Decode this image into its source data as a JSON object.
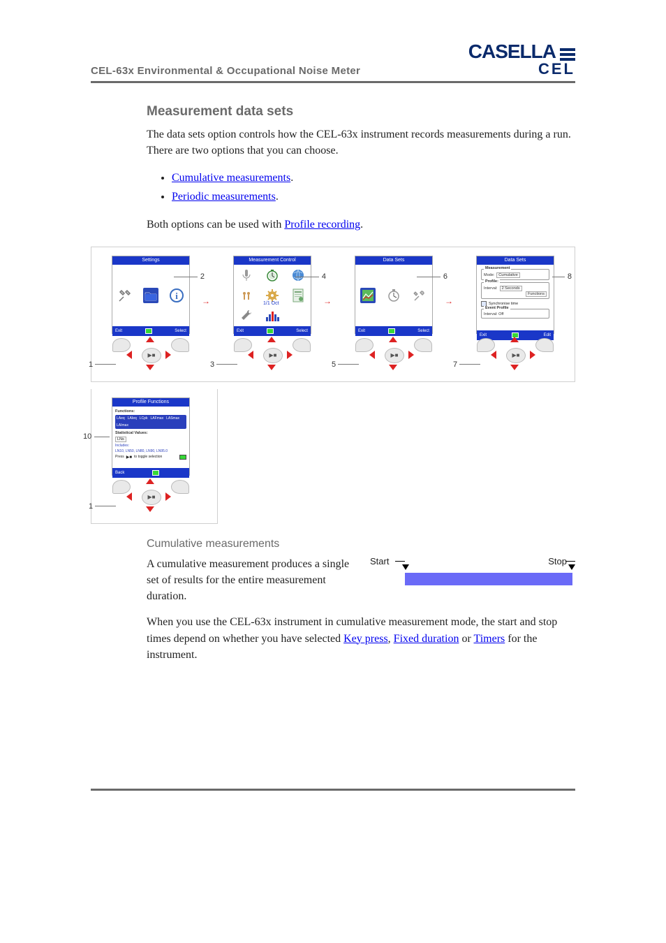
{
  "header": {
    "doc_title": "CEL-63x Environmental & Occupational Noise Meter",
    "logo_top": "CASELLA",
    "logo_bot": "CEL"
  },
  "section": {
    "h2": "Measurement data sets",
    "intro": "The data sets option controls how the CEL-63x instrument records measurements during a run. There are two options that you can choose.",
    "bullets": [
      {
        "link": "Cumulative measurements",
        "suffix": "."
      },
      {
        "link": "Periodic measurements",
        "suffix": "."
      }
    ],
    "both_pre": "Both options can be used with ",
    "both_link": "Profile recording",
    "both_post": "."
  },
  "figure1": {
    "callouts": [
      "1",
      "2",
      "3",
      "4",
      "5",
      "6",
      "7",
      "8",
      "10",
      "1"
    ],
    "screens": [
      {
        "title": "Settings",
        "footer_left": "Exit",
        "footer_right": "Select"
      },
      {
        "title": "Measurement Control",
        "footer_left": "Exit",
        "footer_right": "Select",
        "octave": "1/1 Oct"
      },
      {
        "title": "Data Sets",
        "footer_left": "Exit",
        "footer_right": "Select"
      },
      {
        "title": "Data Sets",
        "footer_left": "Exit",
        "footer_right": "Edit",
        "groups": {
          "measurement_legend": "Measurement",
          "mode_label": "Mode:",
          "mode_value": "Cumulative",
          "profile_legend": "Profile:",
          "interval_label": "Interval:",
          "interval_value": "2 Seconds",
          "functions": "Functions",
          "sync": "Synchronise time",
          "event_legend": "Event Profile",
          "event_interval": "Interval:   Off"
        }
      },
      {
        "title": "Profile Functions",
        "footer_left": "Back",
        "functions_label": "Functions:",
        "tags": [
          "LAeq",
          "LAIeq",
          "LCpk",
          "LAFmax",
          "LASmax",
          "LAImax"
        ],
        "stat_label": "Statistical Values:",
        "stat_value": "LNs",
        "includes_label": "Includes:",
        "includes_value": "LN10, LN50, LN80, LN90, LN95.0",
        "press": "Press",
        "press_suffix": "to toggle selection"
      }
    ]
  },
  "cumulative": {
    "h3": "Cumulative measurements",
    "body": "A cumulative measurement produces a single set of results for the entire measurement duration.",
    "start": "Start",
    "stop": "Stop"
  },
  "para2": {
    "pre": "When you use the CEL-63x instrument in cumulative measurement mode, the start and stop times depend on whether you have selected ",
    "link1": "Key press",
    "sep1": ", ",
    "link2": "Fixed duration",
    "sep2": " or ",
    "link3": "Timers",
    "post": " for the instrument."
  }
}
